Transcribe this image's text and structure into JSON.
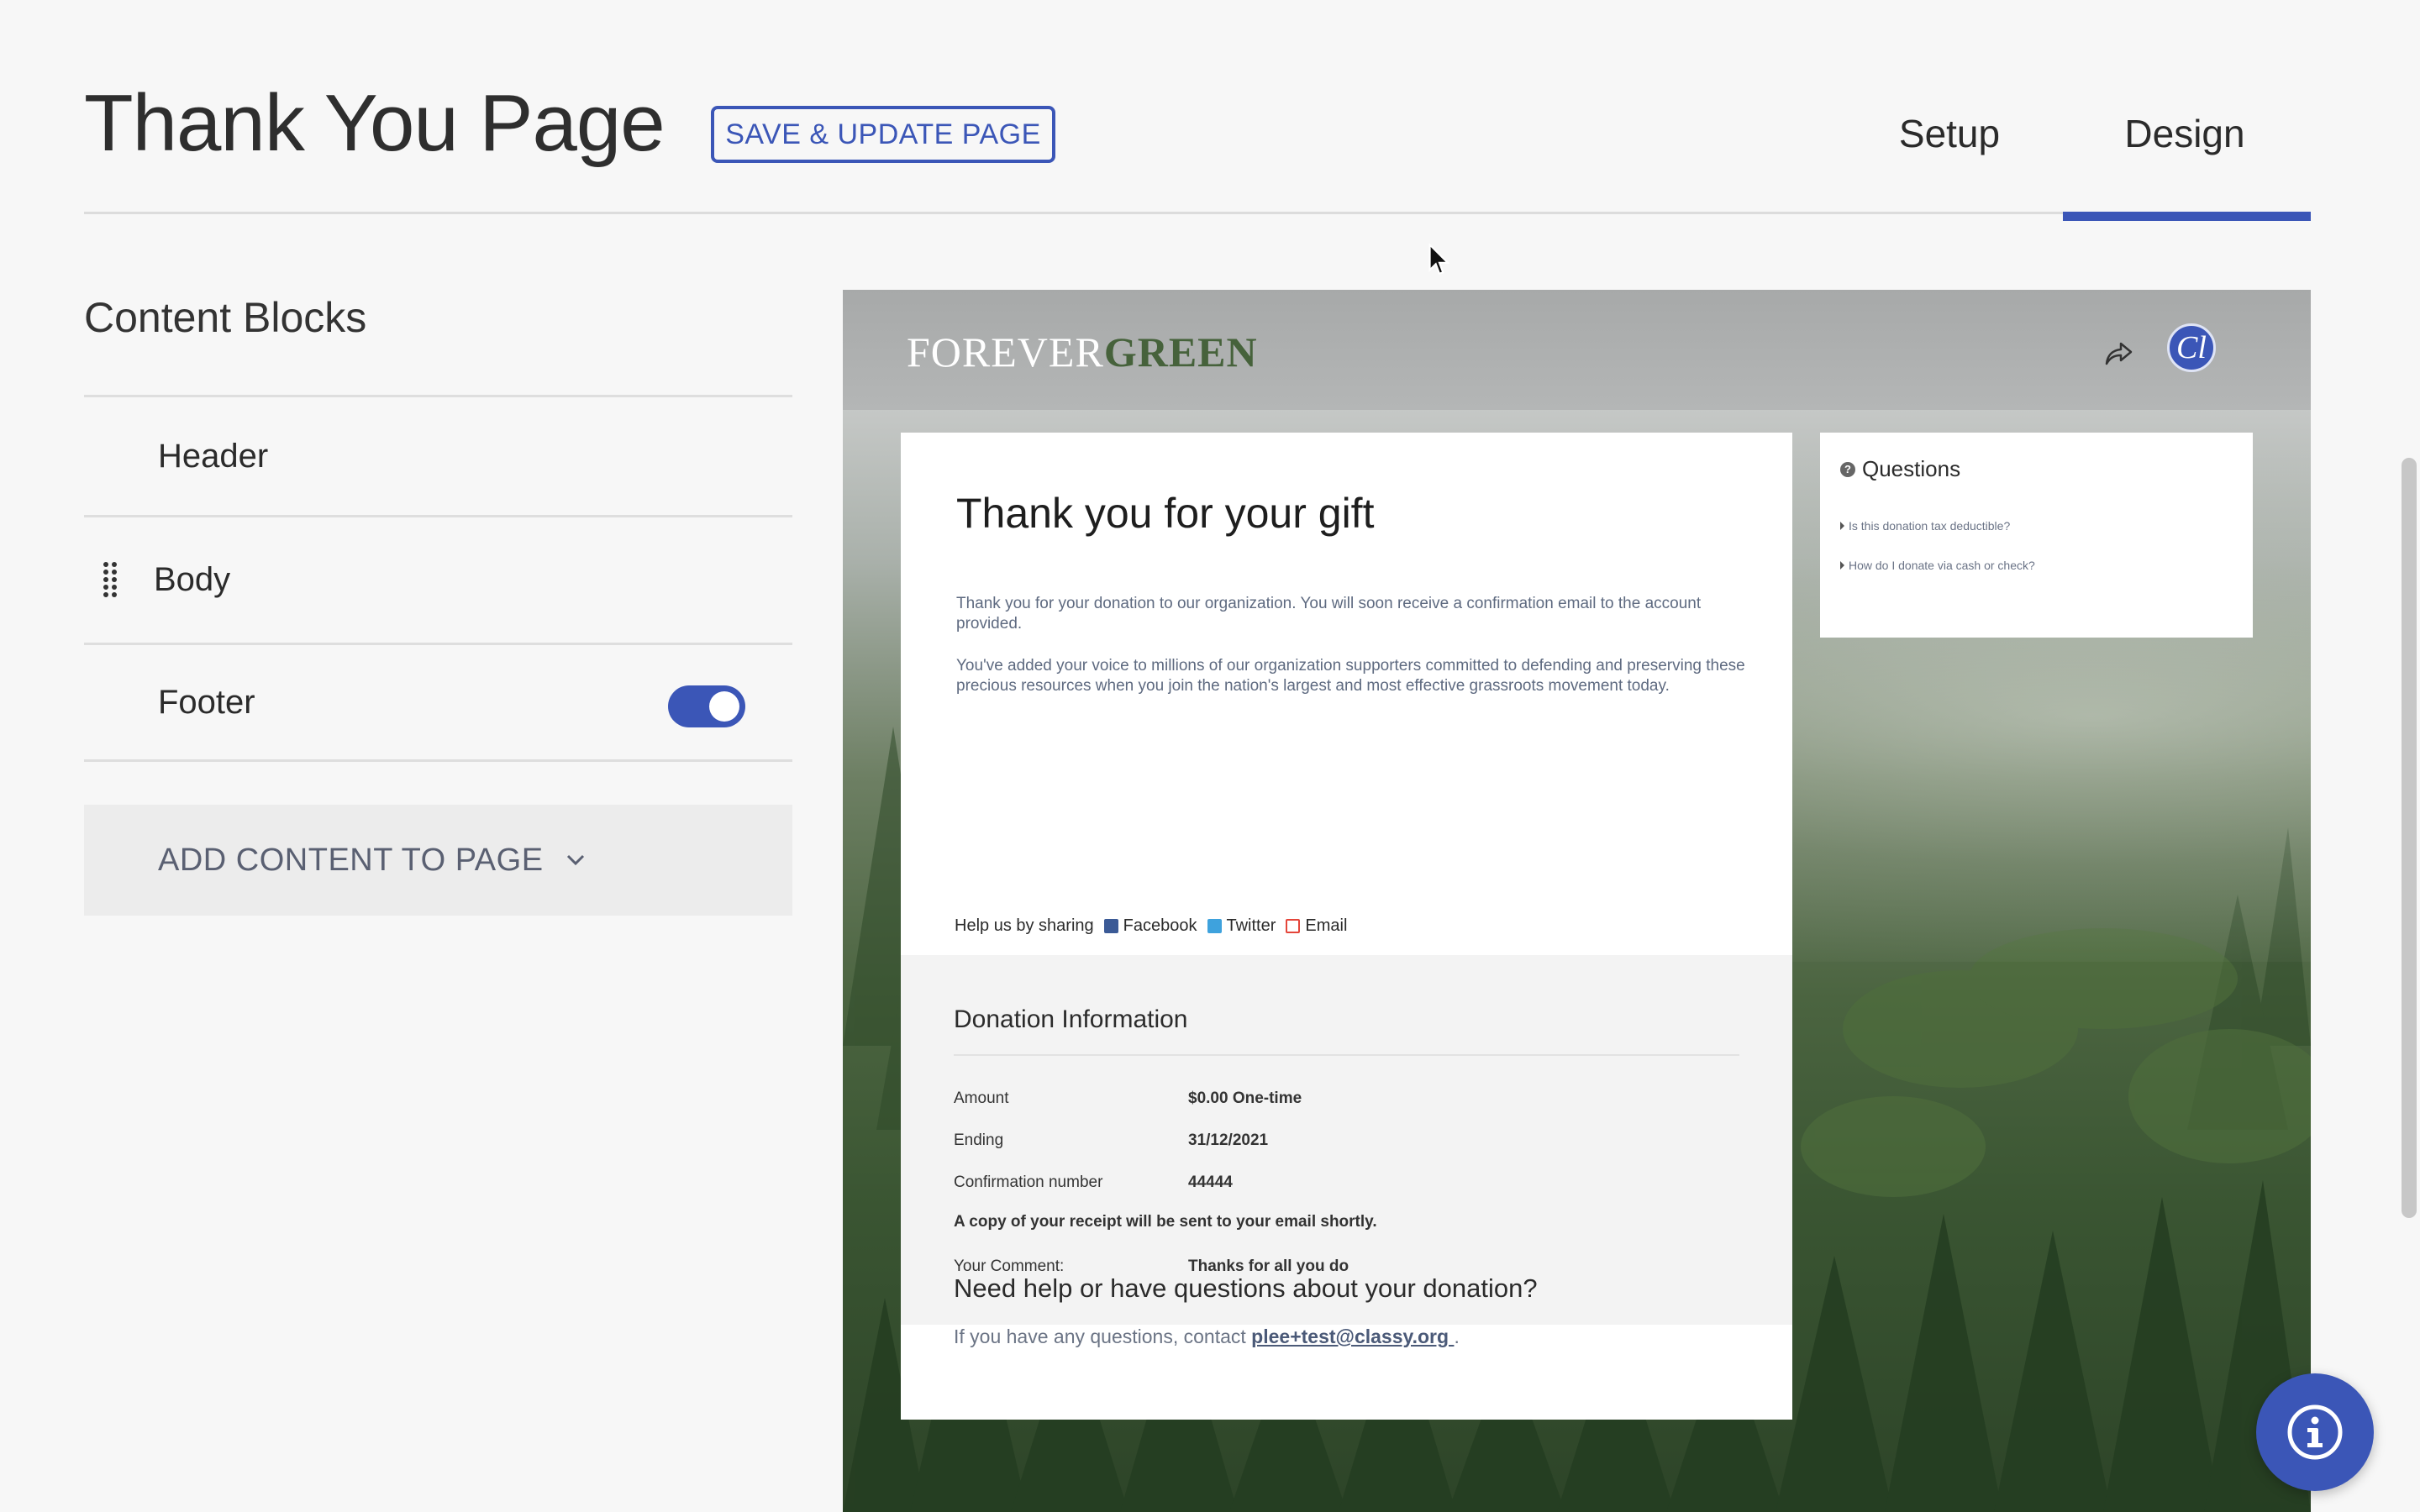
{
  "header": {
    "title": "Thank You Page",
    "save_label": "SAVE & UPDATE PAGE",
    "tabs": [
      {
        "label": "Setup",
        "active": false
      },
      {
        "label": "Design",
        "active": true
      }
    ]
  },
  "sidebar": {
    "title": "Content Blocks",
    "blocks": [
      {
        "label": "Header"
      },
      {
        "label": "Body"
      },
      {
        "label": "Footer",
        "toggle_on": true
      }
    ],
    "add_content_label": "ADD CONTENT TO PAGE"
  },
  "preview": {
    "logo": {
      "part1": "FOREVER",
      "part2": "GREEN"
    },
    "avatar_text": "Cl",
    "thank_you": {
      "title": "Thank you for your gift",
      "paragraph1": "Thank you for your donation to our organization. You will soon receive a confirmation email to the account provided.",
      "paragraph2": "You've added your voice to millions of our organization supporters committed to defending and preserving these precious resources when you join the nation's largest and most effective grassroots movement today."
    },
    "sharing": {
      "prompt": "Help us by sharing",
      "facebook": "Facebook",
      "twitter": "Twitter",
      "email": "Email"
    },
    "donation": {
      "title": "Donation Information",
      "rows": [
        {
          "label": "Amount",
          "value": "$0.00 One-time"
        },
        {
          "label": "Ending",
          "value": "31/12/2021"
        },
        {
          "label": "Confirmation number",
          "value": "44444"
        }
      ],
      "receipt_note": "A copy of your receipt will be sent to your email shortly.",
      "comment_label": "Your Comment:",
      "comment_value": "Thanks for all you do"
    },
    "help": {
      "title": "Need help or have questions about your donation?",
      "text_before": "If you have any questions, contact ",
      "email": "plee+test@classy.org ",
      "text_after": "."
    },
    "questions": {
      "title": "Questions",
      "links": [
        "Is this donation tax deductible?",
        "How do I donate via cash or check?"
      ]
    }
  },
  "colors": {
    "accent": "#3b56b7",
    "logo_green": "#46623b",
    "facebook": "#3b5a96",
    "twitter": "#3ea2dd",
    "email": "#e4453a"
  }
}
